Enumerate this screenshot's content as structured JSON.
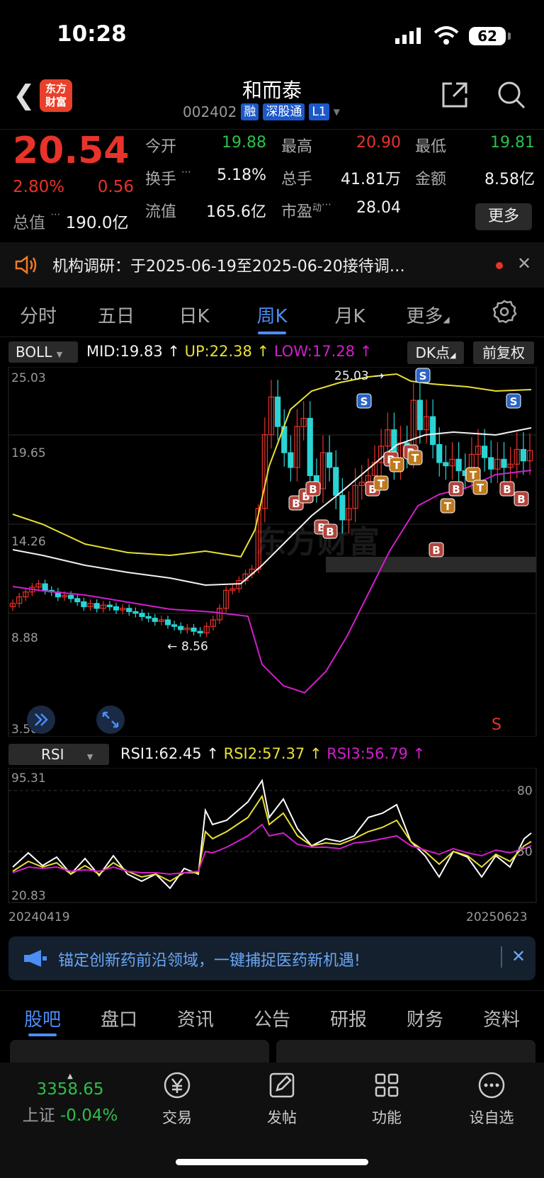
{
  "status": {
    "time": "10:28",
    "battery": "62"
  },
  "header": {
    "title": "和而泰",
    "code": "002402",
    "tags": [
      "融",
      "深股通",
      "L1"
    ],
    "logo": "东方\n财富"
  },
  "quote": {
    "price": "20.54",
    "pct": "2.80%",
    "change": "0.56",
    "total_cap_label": "总值",
    "total_cap": "190.0亿",
    "open_label": "今开",
    "open": "19.88",
    "high_label": "最高",
    "high": "20.90",
    "low_label": "最低",
    "low": "19.81",
    "turnover_label": "换手",
    "turnover": "5.18%",
    "volume_label": "总手",
    "volume": "41.81万",
    "amount_label": "金额",
    "amount": "8.58亿",
    "float_label": "流值",
    "float": "165.6亿",
    "pe_label": "市盈",
    "pe_sup": "动",
    "pe": "28.04",
    "more": "更多"
  },
  "notice": {
    "text": "机构调研：于2025-06-19至2025-06-20接待调…"
  },
  "tabs": [
    "分时",
    "五日",
    "日K",
    "周K",
    "月K",
    "更多"
  ],
  "active_tab": "周K",
  "boll": {
    "name": "BOLL",
    "mid": "MID:19.83",
    "up": "UP:22.38",
    "low": "LOW:17.28",
    "dk_button": "DK点",
    "adjust_button": "前复权",
    "axis": [
      "25.03",
      "19.65",
      "14.26",
      "8.88",
      "3.50"
    ],
    "max_label": "25.03",
    "min_label": "8.56",
    "watermark": "东方财富"
  },
  "rsi": {
    "name": "RSI",
    "rsi1": "RSI1:62.45",
    "rsi2": "RSI2:57.37",
    "rsi3": "RSI3:56.79",
    "axis_top": "95.31",
    "axis_bottom": "20.83",
    "level_80": "80",
    "level_50": "50",
    "date_start": "20240419",
    "date_end": "20250623"
  },
  "colors": {
    "up": "#e8332a",
    "down": "#2dbf4a",
    "accent": "#4c8df6",
    "boll_up": "#e8e033",
    "boll_low": "#d21ecc",
    "boll_mid": "#f2f2f2"
  },
  "ad": {
    "text": "锚定创新药前沿领域，一键捕捉医药新机遇!"
  },
  "bottom_tabs": [
    "股吧",
    "盘口",
    "资讯",
    "公告",
    "研报",
    "财务",
    "资料"
  ],
  "dock": {
    "index_value": "3358.65",
    "index_name": "上证",
    "index_pct": "-0.04%",
    "items": [
      "交易",
      "发帖",
      "功能",
      "设自选"
    ]
  }
}
